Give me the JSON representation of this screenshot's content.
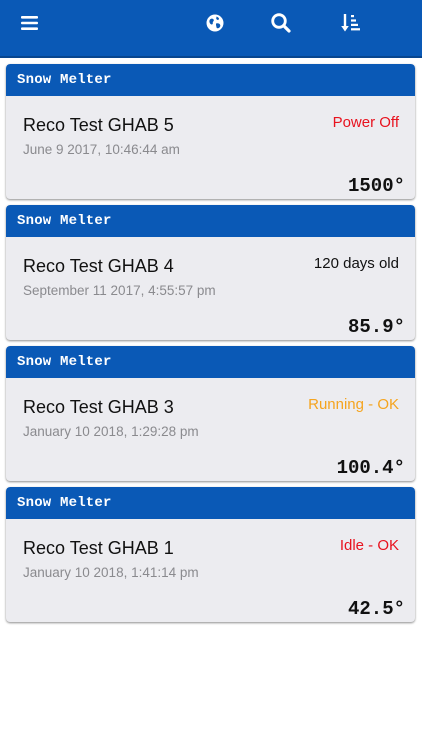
{
  "toolbar": {
    "menu_icon": "hamburger-menu-icon",
    "globe_icon": "globe-icon",
    "search_icon": "search-icon",
    "sort_icon": "sort-icon",
    "bar_color": "#0a59b6"
  },
  "devices": [
    {
      "type": "Snow Melter",
      "name": "Reco Test GHAB 5",
      "date": "June 9 2017, 10:46:44 am",
      "status": "Power Off",
      "status_color": "#e8121e",
      "temperature": "1500°"
    },
    {
      "type": "Snow Melter",
      "name": "Reco Test GHAB 4",
      "date": "September 11 2017, 4:55:57 pm",
      "status": "120 days old",
      "status_color": "#111111",
      "temperature": "85.9°"
    },
    {
      "type": "Snow Melter",
      "name": "Reco Test GHAB 3",
      "date": "January 10 2018, 1:29:28 pm",
      "status": "Running - OK",
      "status_color": "#f5a41f",
      "temperature": "100.4°"
    },
    {
      "type": "Snow Melter",
      "name": "Reco Test GHAB 1",
      "date": "January 10 2018, 1:41:14 pm",
      "status": "Idle - OK",
      "status_color": "#e8121e",
      "temperature": "42.5°"
    }
  ]
}
